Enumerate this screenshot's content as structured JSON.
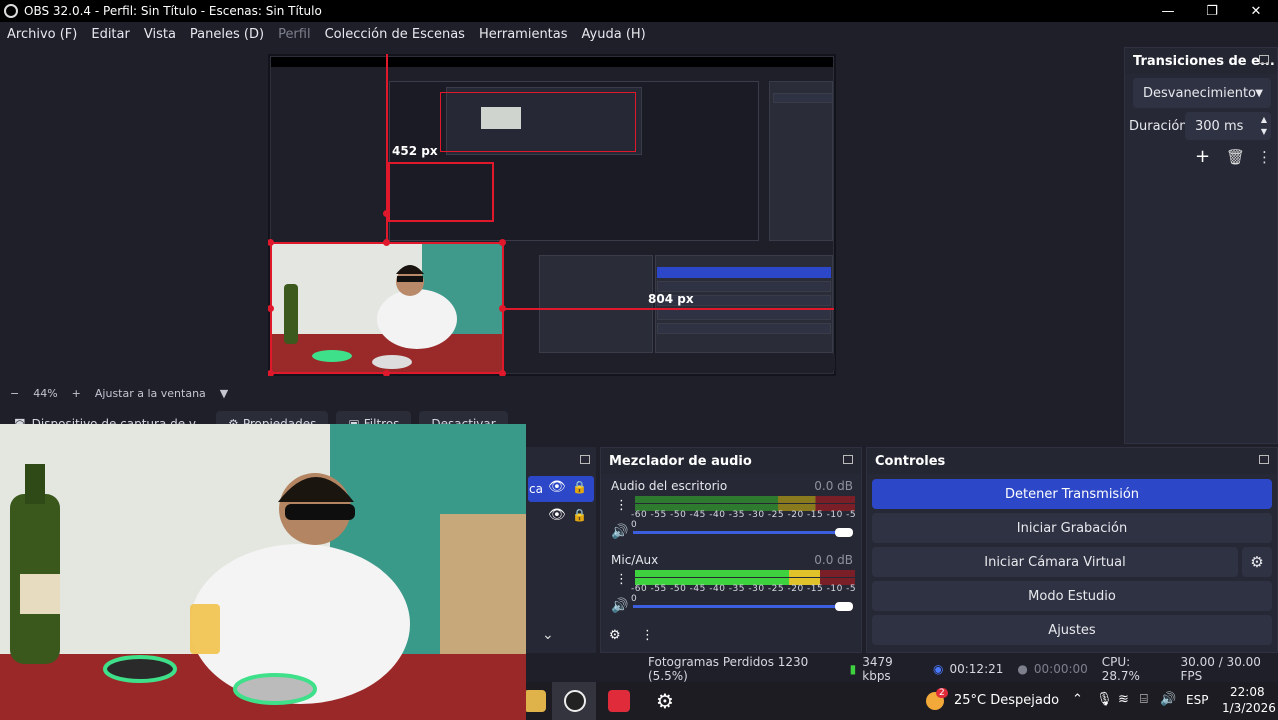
{
  "window": {
    "title": "OBS 32.0.4 - Perfil: Sin Título - Escenas: Sin Título",
    "controls": [
      "—",
      "❐",
      "✕"
    ]
  },
  "menu": [
    {
      "label": "Archivo (F)",
      "disabled": false
    },
    {
      "label": "Editar",
      "disabled": false
    },
    {
      "label": "Vista",
      "disabled": false
    },
    {
      "label": "Paneles (D)",
      "disabled": false
    },
    {
      "label": "Perfil",
      "disabled": true
    },
    {
      "label": "Colección de Escenas",
      "disabled": false
    },
    {
      "label": "Herramientas",
      "disabled": false
    },
    {
      "label": "Ayuda (H)",
      "disabled": false
    }
  ],
  "preview": {
    "height_label": "452 px",
    "width_label": "804 px"
  },
  "zoom": {
    "minus": "−",
    "value": "44%",
    "plus": "+",
    "fit": "Ajustar a la ventana",
    "arrow": "▼"
  },
  "source_toolbar": {
    "source_name": "Dispositivo de captura de v",
    "properties": "Propiedades",
    "filters": "Filtros",
    "deactivate": "Desactivar"
  },
  "transitions": {
    "title": "Transiciones de e...",
    "selected": "Desvanecimiento",
    "duration_label": "Duración",
    "duration_value": "300 ms"
  },
  "sources": {
    "item_label": "ca"
  },
  "mixer": {
    "title": "Mezclador de audio",
    "scale": "-60 -55 -50 -45 -40 -35 -30 -25 -20 -15 -10 -5 0",
    "tracks": [
      {
        "name": "Audio del escritorio",
        "db": "0.0 dB"
      },
      {
        "name": "Mic/Aux",
        "db": "0.0 dB"
      }
    ]
  },
  "controls": {
    "title": "Controles",
    "buttons": {
      "stop_stream": "Detener Transmisión",
      "start_record": "Iniciar Grabación",
      "start_virtualcam": "Iniciar Cámara Virtual",
      "studio_mode": "Modo Estudio",
      "settings": "Ajustes"
    }
  },
  "status": {
    "dropped": "Fotogramas Perdidos 1230 (5.5%)",
    "bitrate": "3479 kbps",
    "stream_time": "00:12:21",
    "record_time": "00:00:00",
    "cpu": "CPU: 28.7%",
    "fps": "30.00 / 30.00 FPS"
  },
  "taskbar": {
    "weather_badge": "2",
    "weather": "25°C  Despejado",
    "language": "ESP",
    "time": "22:08",
    "date": "1/3/2026"
  },
  "colors": {
    "accent": "#2c47c7",
    "selection_red": "#e0182b",
    "meter_green": "#3fbf3f",
    "meter_yellow": "#d8c12a",
    "meter_red": "#d23a3a"
  }
}
